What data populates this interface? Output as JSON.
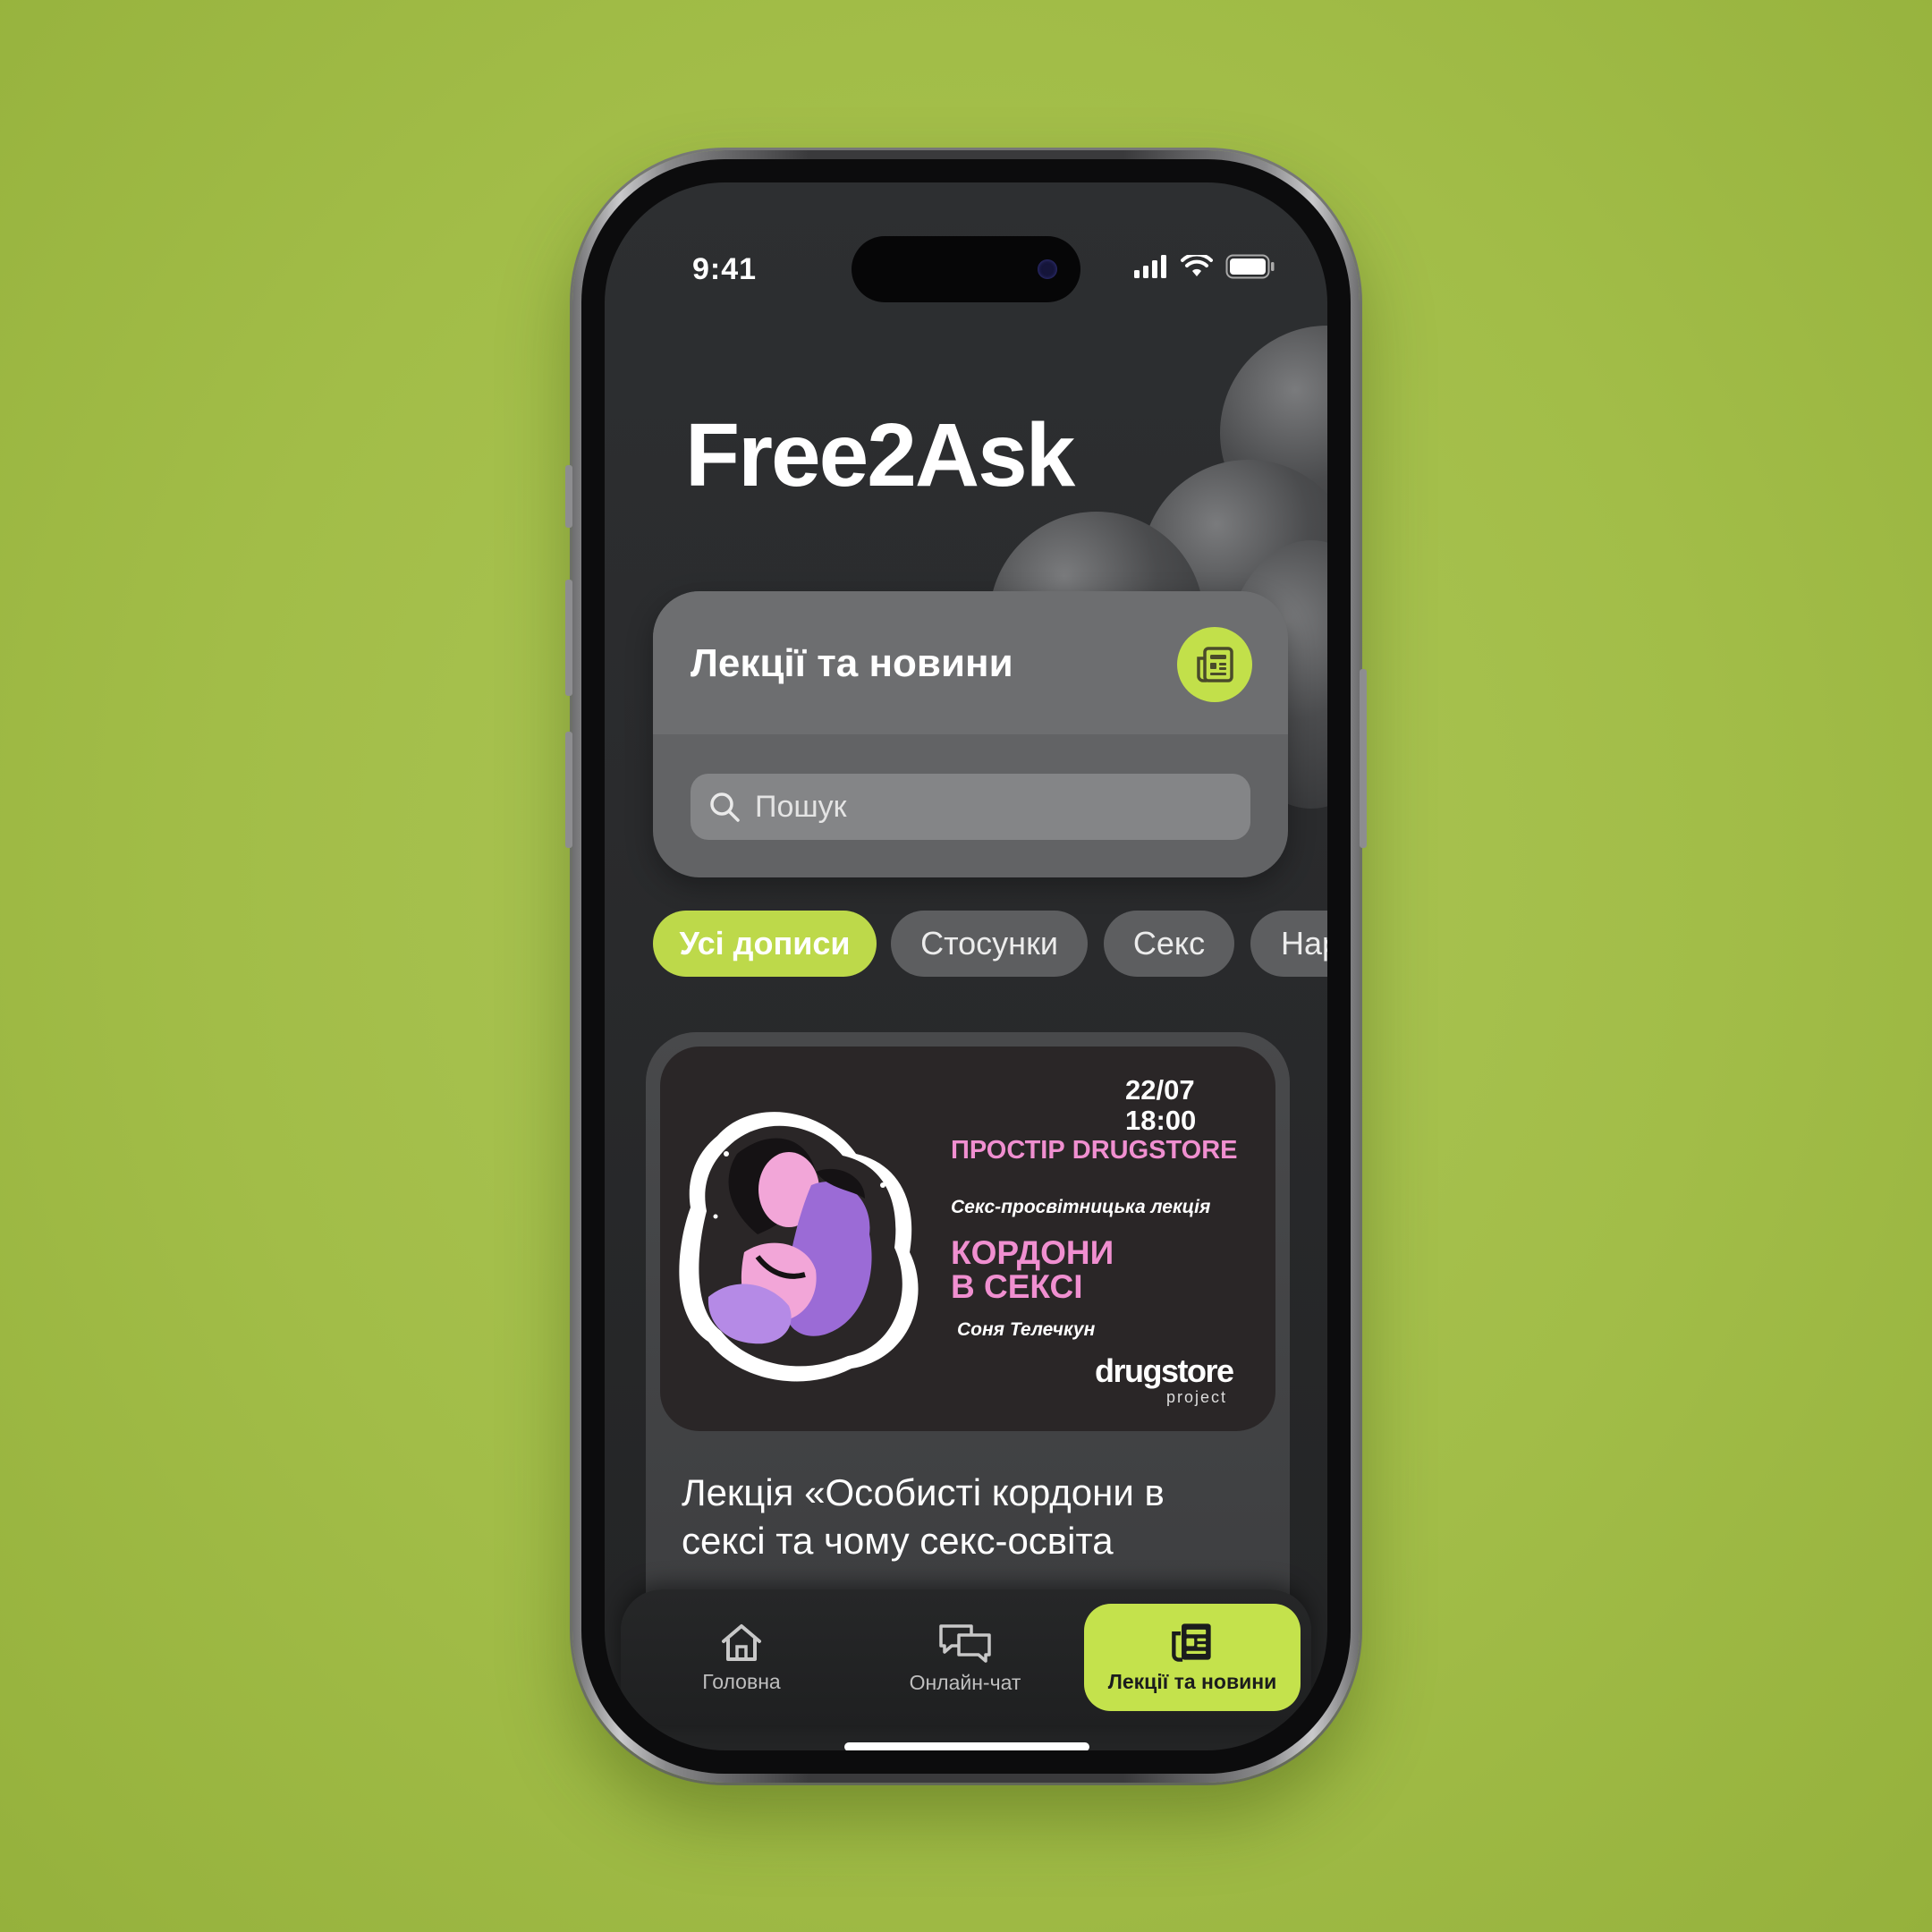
{
  "status": {
    "time": "9:41"
  },
  "app": {
    "title": "Free2Ask"
  },
  "section": {
    "title": "Лекції та новини",
    "icon": "newspaper-icon"
  },
  "search": {
    "placeholder": "Пошук",
    "icon": "search-icon"
  },
  "chips": [
    {
      "label": "Усі дописи",
      "active": true
    },
    {
      "label": "Стосунки",
      "active": false
    },
    {
      "label": "Секс",
      "active": false
    },
    {
      "label": "Нар",
      "active": false
    }
  ],
  "post": {
    "poster": {
      "date": "22/07",
      "time": "18:00",
      "venue": "ПРОСТІР DRUGSTORE",
      "subtitle": "Секс-просвітницька лекція",
      "headline_1": "КОРДОНИ",
      "headline_2": "В СЕКСІ",
      "author": "Соня Телечкун",
      "logo": "drugstore",
      "logo_sub": "project"
    },
    "title": "Лекція «Особисті кордони в сексі та чому секс-освіта"
  },
  "tabs": [
    {
      "label": "Головна",
      "icon": "home-icon",
      "active": false
    },
    {
      "label": "Онлайн-чат",
      "icon": "chat-icon",
      "active": false
    },
    {
      "label": "Лекції та новини",
      "icon": "newspaper-icon",
      "active": true
    }
  ],
  "colors": {
    "accent": "#c4e24c",
    "background": "#a5bf4a",
    "screen": "#2b2c2e",
    "poster_pink": "#f08fd0"
  }
}
